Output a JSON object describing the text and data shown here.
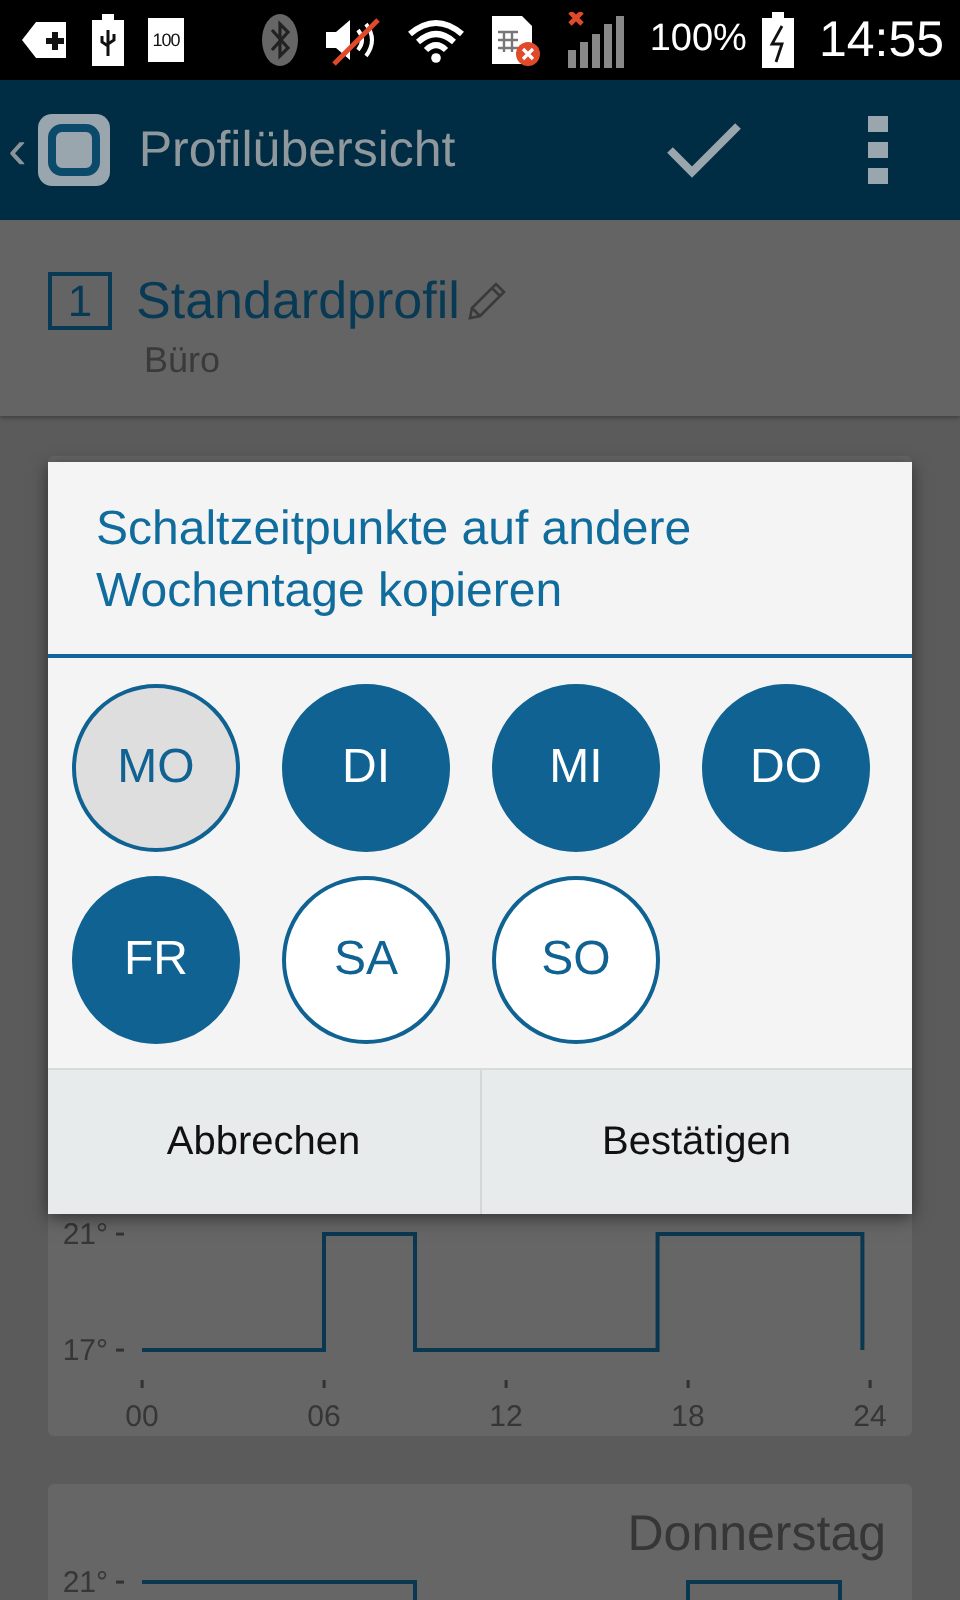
{
  "status_bar": {
    "battery_icon_label": "100",
    "battery_percent": "100%",
    "time": "14:55"
  },
  "app_bar": {
    "back": "‹",
    "title": "Profilübersicht"
  },
  "profile": {
    "number": "1",
    "name": "Standardprofil",
    "subtitle": "Büro"
  },
  "schedule_cards": [
    {
      "chart_data": {
        "type": "line",
        "xlim": [
          0,
          24
        ],
        "ylim": [
          17,
          21
        ],
        "x": [
          0,
          6,
          6,
          9,
          9,
          17,
          17,
          23.75,
          23.75
        ],
        "series": [
          {
            "color": "#0a3850",
            "values": [
              17,
              17,
              21,
              21,
              17,
              17,
              21,
              21,
              17
            ]
          }
        ],
        "xticks": [
          {
            "value": 0,
            "label": "00"
          },
          {
            "value": 6,
            "label": "06"
          },
          {
            "value": 12,
            "label": "12"
          },
          {
            "value": 18,
            "label": "18"
          },
          {
            "value": 24,
            "label": "24"
          }
        ],
        "yticks": [
          {
            "value": 17,
            "label": "17°"
          },
          {
            "value": 21,
            "label": "21°"
          }
        ]
      }
    },
    {
      "day": "Donnerstag",
      "axis_label": "21°"
    }
  ],
  "dialog": {
    "title": "Schaltzeitpunkte auf andere Wochentage kopieren",
    "days": [
      {
        "label": "MO",
        "selected": false,
        "disabled": true
      },
      {
        "label": "DI",
        "selected": true,
        "disabled": false
      },
      {
        "label": "MI",
        "selected": true,
        "disabled": false
      },
      {
        "label": "DO",
        "selected": true,
        "disabled": false
      },
      {
        "label": "FR",
        "selected": true,
        "disabled": false
      },
      {
        "label": "SA",
        "selected": false,
        "disabled": false
      },
      {
        "label": "SO",
        "selected": false,
        "disabled": false
      }
    ],
    "buttons": [
      "Abbrechen",
      "Bestätigen"
    ]
  }
}
